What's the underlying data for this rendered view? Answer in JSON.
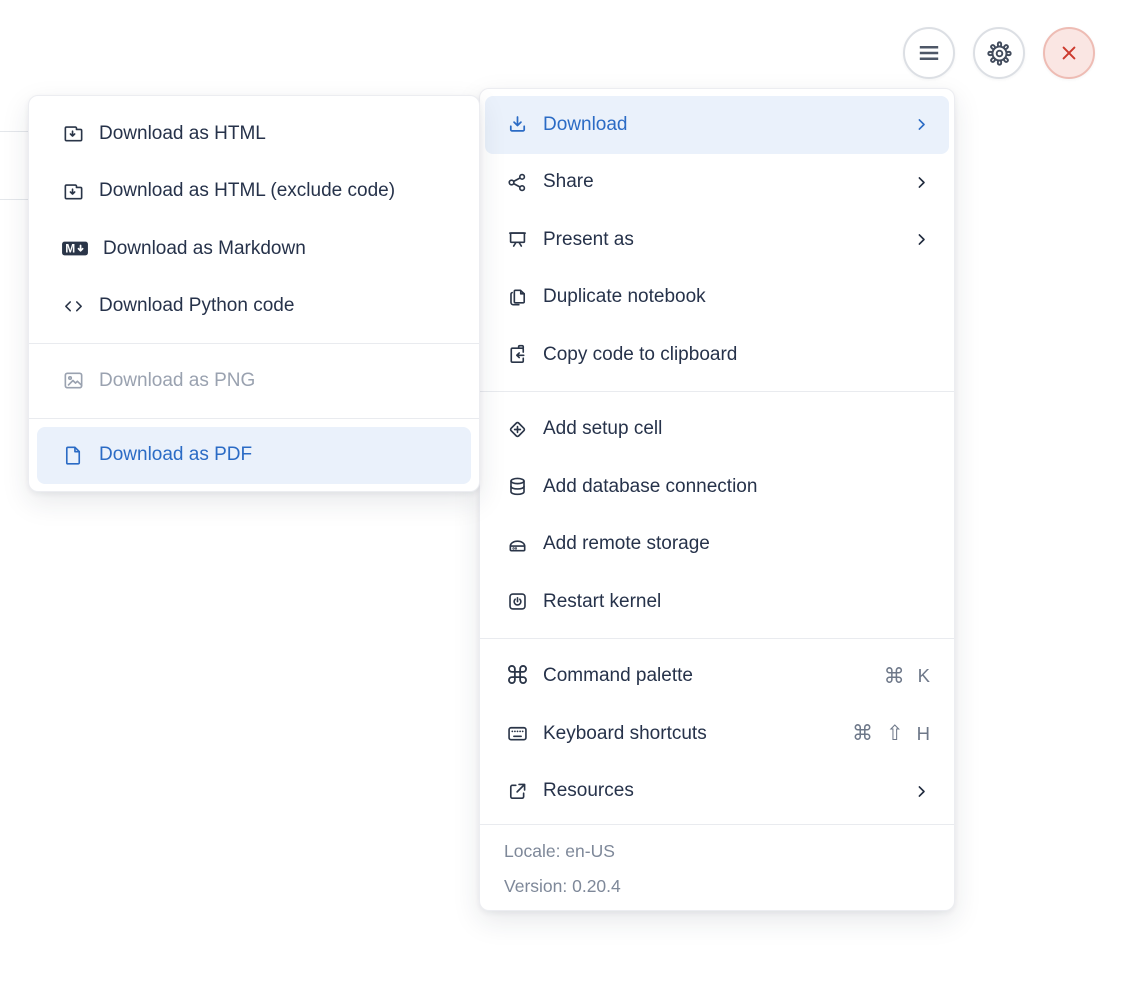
{
  "colors": {
    "accent_blue": "#2B6BC5",
    "highlight_bg": "#EAF1FB",
    "text_dark": "#26324A",
    "text_disabled": "#9AA2B0",
    "text_muted": "#7E8899",
    "shortcut_gray": "#6E7889",
    "divider": "#E9EBEF",
    "close_red": "#CC3A2E",
    "close_bg": "#FAE6E3"
  },
  "window_controls": {
    "buttons": [
      {
        "name": "menu",
        "icon": "hamburger-icon"
      },
      {
        "name": "settings",
        "icon": "gear-icon"
      },
      {
        "name": "close",
        "icon": "close-icon"
      }
    ]
  },
  "download_submenu": {
    "markdown_letter": "M",
    "items": [
      {
        "label": "Download as HTML",
        "icon": "folder-download-icon",
        "state": "normal"
      },
      {
        "label": "Download as HTML (exclude code)",
        "icon": "folder-download-icon",
        "state": "normal"
      },
      {
        "label": "Download as Markdown",
        "icon": "markdown-icon",
        "state": "normal"
      },
      {
        "label": "Download Python code",
        "icon": "code-icon",
        "state": "normal"
      },
      {
        "label": "Download as PNG",
        "icon": "image-icon",
        "state": "disabled"
      },
      {
        "label": "Download as PDF",
        "icon": "file-icon",
        "state": "highlighted"
      }
    ]
  },
  "main_menu": {
    "command_glyph": "⌘",
    "sections": [
      {
        "items": [
          {
            "label": "Download",
            "icon": "download-icon",
            "chevron": true,
            "state": "highlighted"
          },
          {
            "label": "Share",
            "icon": "share-icon",
            "chevron": true
          },
          {
            "label": "Present as",
            "icon": "present-icon",
            "chevron": true
          },
          {
            "label": "Duplicate notebook",
            "icon": "duplicate-icon"
          },
          {
            "label": "Copy code to clipboard",
            "icon": "clipboard-paste-icon"
          }
        ]
      },
      {
        "items": [
          {
            "label": "Add setup cell",
            "icon": "diamond-plus-icon"
          },
          {
            "label": "Add database connection",
            "icon": "database-icon"
          },
          {
            "label": "Add remote storage",
            "icon": "storage-icon"
          },
          {
            "label": "Restart kernel",
            "icon": "power-icon"
          }
        ]
      },
      {
        "items": [
          {
            "label": "Command palette",
            "icon": "command-icon",
            "shortcut": [
              "⌘",
              "K"
            ]
          },
          {
            "label": "Keyboard shortcuts",
            "icon": "keyboard-icon",
            "shortcut": [
              "⌘",
              "⇧",
              "H"
            ]
          },
          {
            "label": "Resources",
            "icon": "external-link-icon",
            "chevron": true
          }
        ]
      }
    ],
    "footer": {
      "locale": "Locale: en-US",
      "version": "Version: 0.20.4"
    }
  }
}
